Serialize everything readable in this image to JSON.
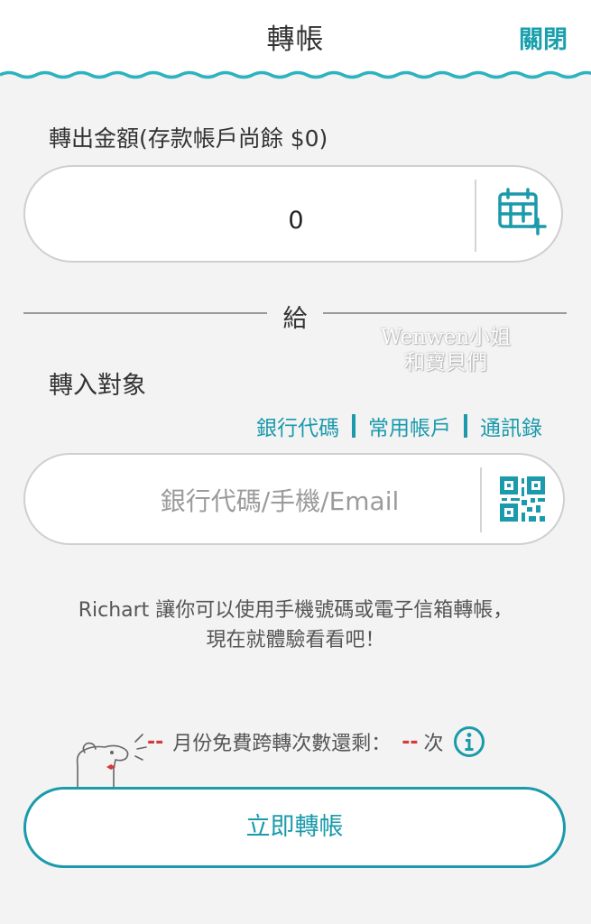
{
  "header": {
    "title": "轉帳",
    "close_label": "關閉"
  },
  "transfer_out": {
    "label": "轉出金額(存款帳戶尚餘 $0)",
    "amount": "0",
    "schedule_icon": "calendar-plus-icon"
  },
  "divider": {
    "label": "給"
  },
  "watermark": {
    "line1": "Wenwen小姐",
    "line2": "和寶貝們"
  },
  "transfer_in": {
    "label": "轉入對象",
    "links": [
      "銀行代碼",
      "常用帳戶",
      "通訊錄"
    ],
    "input_placeholder": "銀行代碼/手機/Email",
    "input_value": "",
    "scan_icon": "qr-code-icon"
  },
  "promo": {
    "line1": "Richart 讓你可以使用手機號碼或電子信箱轉帳，",
    "line2": "現在就體驗看看吧！"
  },
  "quota": {
    "prefix_value": "--",
    "text": "月份免費跨轉次數還剩：",
    "count_value": "--",
    "unit": "次"
  },
  "submit": {
    "label": "立即轉帳"
  },
  "colors": {
    "accent": "#1a9aab",
    "background": "#f3f3f3",
    "warning": "#d43a3a"
  }
}
